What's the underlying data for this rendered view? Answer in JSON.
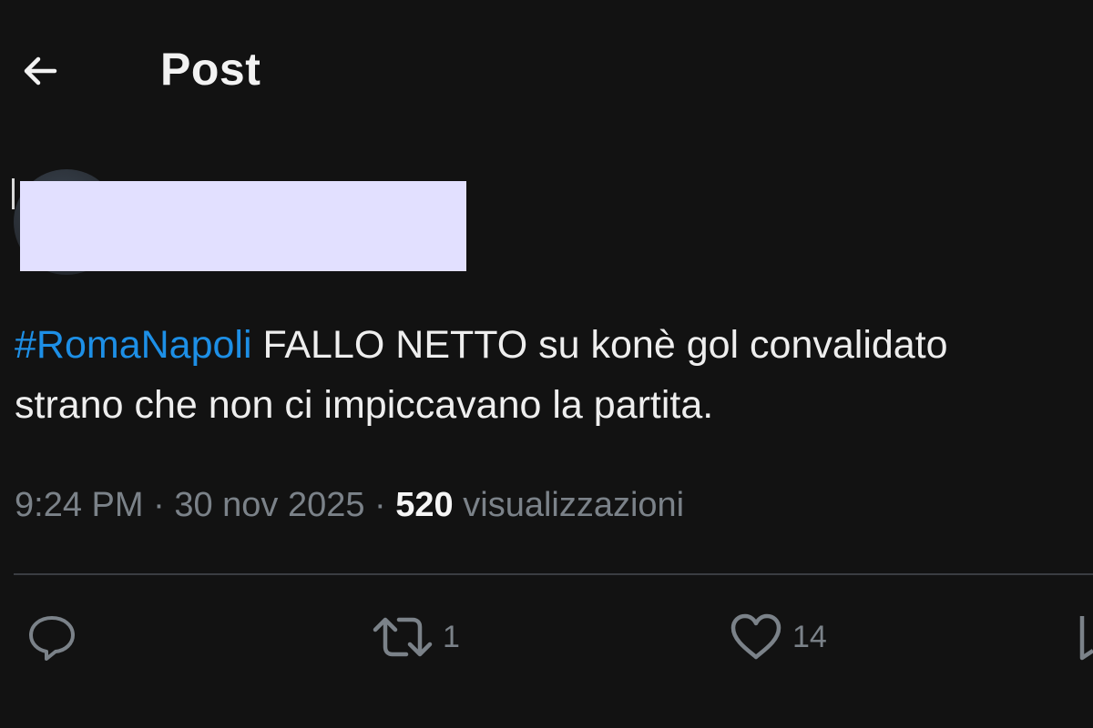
{
  "header": {
    "title": "Post",
    "back_icon": "arrow-left-icon"
  },
  "author": {
    "avatar_icon": "avatar",
    "name_redacted": true
  },
  "tweet": {
    "hashtag": "#RomaNapoli",
    "text_line1": " FALLO NETTO su konè gol convalidato",
    "text_line2": "strano che non ci impiccavano la partita."
  },
  "meta": {
    "time": "9:24 PM",
    "separator": " · ",
    "date": "30 nov 2025",
    "separator2": " · ",
    "views_count": "520",
    "views_label": " visualizzazioni"
  },
  "actions": {
    "reply": {
      "icon": "reply-icon",
      "count": ""
    },
    "repost": {
      "icon": "repost-icon",
      "count": "1"
    },
    "like": {
      "icon": "heart-icon",
      "count": "14"
    },
    "bookmark": {
      "icon": "bookmark-icon",
      "count": ""
    }
  },
  "colors": {
    "background": "#121212",
    "hashtag": "#1d8fe6",
    "muted": "#7b8289",
    "redaction": "#e2e0ff"
  }
}
